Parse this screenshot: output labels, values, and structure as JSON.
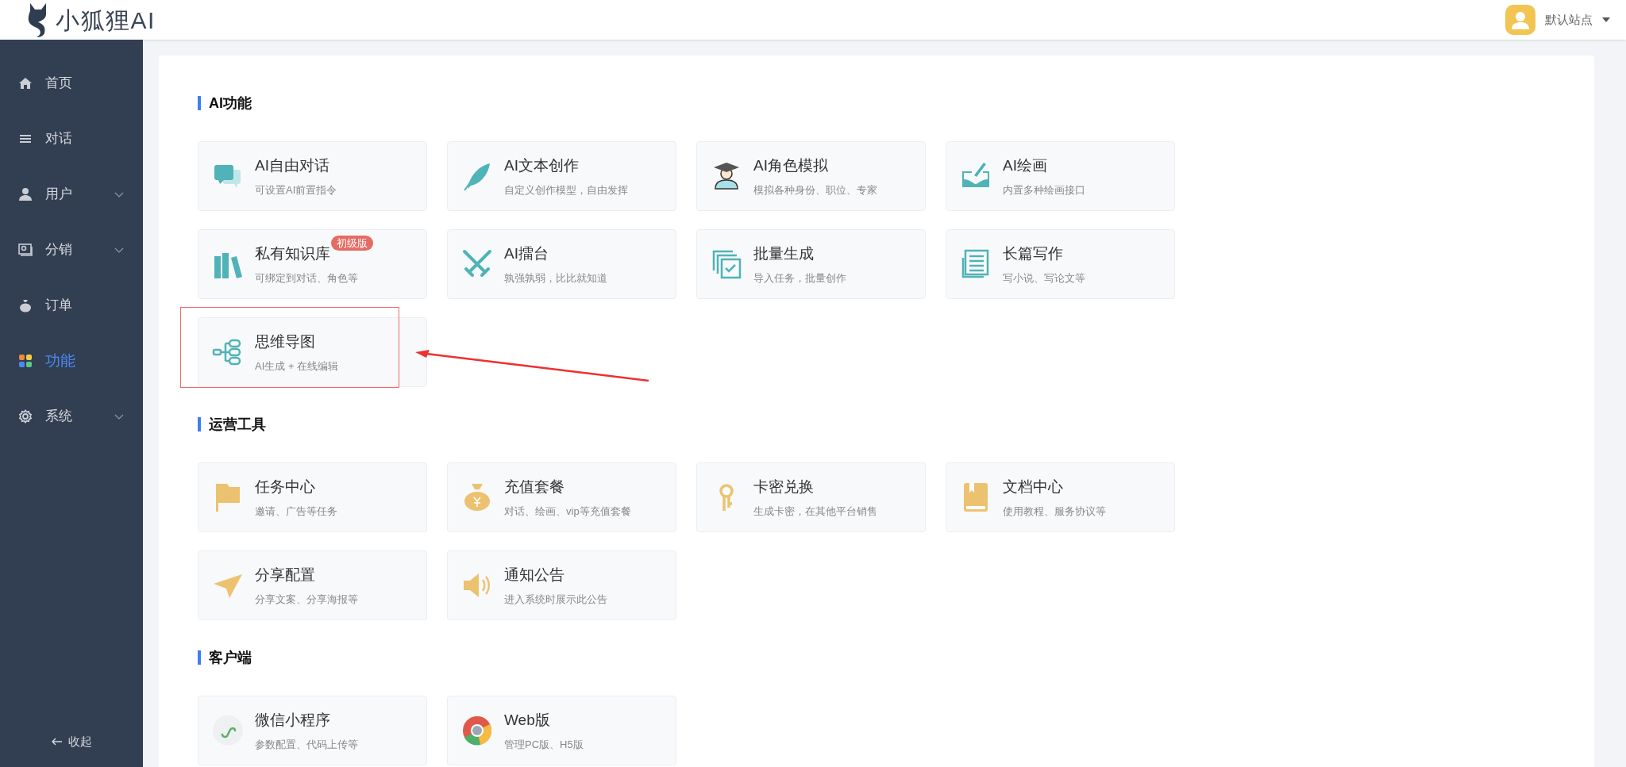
{
  "header": {
    "logo_text": "小狐狸AI",
    "site_name": "默认站点"
  },
  "sidebar": {
    "items": [
      {
        "label": "首页",
        "kind": "home",
        "selected": false,
        "has_children": false
      },
      {
        "label": "对话",
        "kind": "list",
        "selected": false,
        "has_children": false
      },
      {
        "label": "用户",
        "kind": "user",
        "selected": false,
        "has_children": true
      },
      {
        "label": "分销",
        "kind": "share",
        "selected": false,
        "has_children": true
      },
      {
        "label": "订单",
        "kind": "bag",
        "selected": false,
        "has_children": false
      },
      {
        "label": "功能",
        "kind": "apps",
        "selected": true,
        "has_children": false
      },
      {
        "label": "系统",
        "kind": "gear",
        "selected": false,
        "has_children": true
      }
    ],
    "collapse": "收起"
  },
  "sections": [
    {
      "title": "AI功能",
      "cards": [
        {
          "title": "AI自由对话",
          "desc": "可设置AI前置指令",
          "kind": "chat"
        },
        {
          "title": "AI文本创作",
          "desc": "自定义创作模型，自由发挥",
          "kind": "feather"
        },
        {
          "title": "AI角色模拟",
          "desc": "模拟各种身份、职位、专家",
          "kind": "graduate"
        },
        {
          "title": "AI绘画",
          "desc": "内置多种绘画接口",
          "kind": "paint"
        },
        {
          "title": "私有知识库",
          "desc": "可绑定到对话、角色等",
          "kind": "books",
          "badge": "初级版"
        },
        {
          "title": "AI擂台",
          "desc": "孰强孰弱，比比就知道",
          "kind": "swords"
        },
        {
          "title": "批量生成",
          "desc": "导入任务，批量创作",
          "kind": "batch"
        },
        {
          "title": "长篇写作",
          "desc": "写小说、写论文等",
          "kind": "doc"
        },
        {
          "title": "思维导图",
          "desc": "AI生成 + 在线编辑",
          "kind": "mindmap",
          "highlighted": true
        }
      ]
    },
    {
      "title": "运营工具",
      "cards": [
        {
          "title": "任务中心",
          "desc": "邀请、广告等任务",
          "kind": "flag"
        },
        {
          "title": "充值套餐",
          "desc": "对话、绘画、vip等充值套餐",
          "kind": "moneybag"
        },
        {
          "title": "卡密兑换",
          "desc": "生成卡密，在其他平台销售",
          "kind": "key"
        },
        {
          "title": "文档中心",
          "desc": "使用教程、服务协议等",
          "kind": "book"
        },
        {
          "title": "分享配置",
          "desc": "分享文案、分享海报等",
          "kind": "plane"
        },
        {
          "title": "通知公告",
          "desc": "进入系统时展示此公告",
          "kind": "speaker"
        }
      ]
    },
    {
      "title": "客户端",
      "cards": [
        {
          "title": "微信小程序",
          "desc": "参数配置、代码上传等",
          "kind": "miniprogram"
        },
        {
          "title": "Web版",
          "desc": "管理PC版、H5版",
          "kind": "chrome"
        }
      ]
    }
  ]
}
